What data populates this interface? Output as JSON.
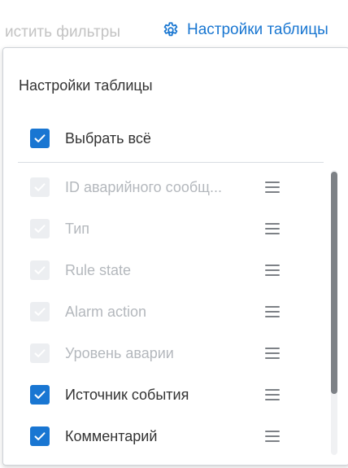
{
  "toolbar": {
    "clear_filters_label": "истить фильтры",
    "table_settings_link": "Настройки таблицы",
    "link_icon": "gear-icon",
    "link_color": "#1876d1"
  },
  "panel": {
    "title": "Настройки таблицы",
    "select_all": {
      "label": "Выбрать всё",
      "checked": true
    },
    "columns": [
      {
        "label": "ID аварийного сообщ...",
        "checked": true,
        "disabled": true
      },
      {
        "label": "Тип",
        "checked": true,
        "disabled": true
      },
      {
        "label": "Rule state",
        "checked": true,
        "disabled": true
      },
      {
        "label": "Alarm action",
        "checked": true,
        "disabled": true
      },
      {
        "label": "Уровень аварии",
        "checked": true,
        "disabled": true
      },
      {
        "label": "Источник события",
        "checked": true,
        "disabled": false
      },
      {
        "label": "Комментарий",
        "checked": true,
        "disabled": false
      }
    ],
    "row_icon": "drag-handle-icon",
    "checkbox_color": "#1976d2"
  }
}
